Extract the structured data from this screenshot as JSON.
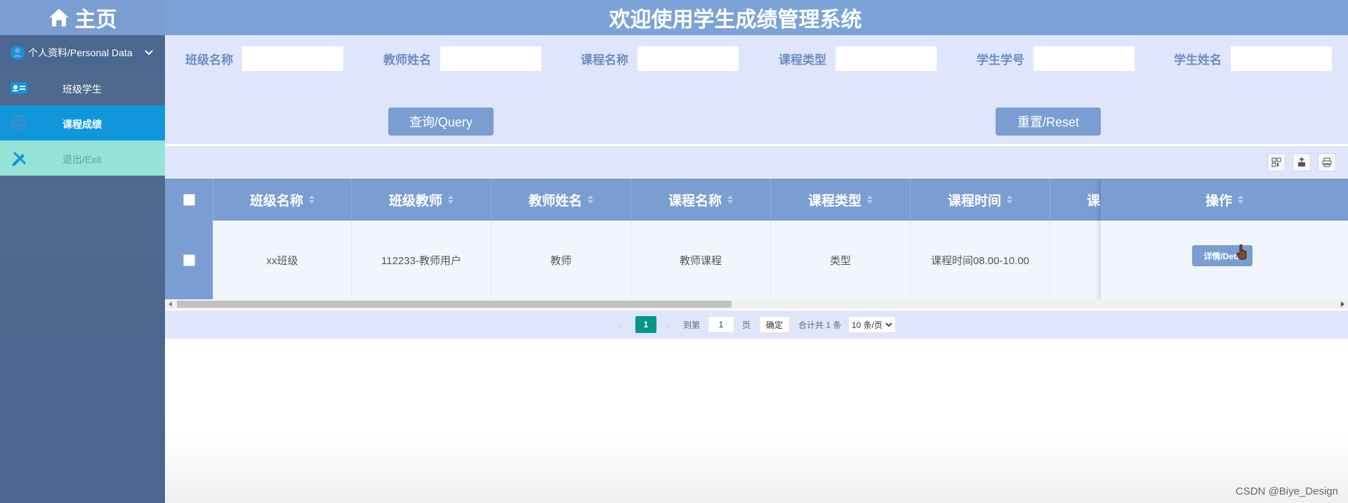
{
  "sidebar": {
    "home_label": "主页",
    "group_label": "个人资料/Personal Data",
    "items": [
      {
        "label": "班级学生",
        "icon": "id-card-icon"
      },
      {
        "label": "课程成绩",
        "icon": "target-icon"
      },
      {
        "label": "退出/Exit",
        "icon": "pencil-ruler-icon"
      }
    ]
  },
  "header": {
    "title": "欢迎使用学生成绩管理系统"
  },
  "search": {
    "fields": [
      "班级名称",
      "教师姓名",
      "课程名称",
      "课程类型",
      "学生学号",
      "学生姓名"
    ],
    "query_button": "查询/Query",
    "reset_button": "重置/Reset"
  },
  "toolbar": {
    "icons": [
      "columns-icon",
      "export-icon",
      "print-icon"
    ]
  },
  "table": {
    "headers": [
      "班级名称",
      "班级教师",
      "教师姓名",
      "课程名称",
      "课程类型",
      "课程时间",
      "课"
    ],
    "action_header": "操作",
    "rows": [
      [
        "xx班级",
        "112233-教师用户",
        "教师",
        "教师课程",
        "类型",
        "课程时间08.00-10.00",
        ""
      ]
    ],
    "detail_button": "详情/Deta"
  },
  "pager": {
    "current_page": "1",
    "goto_label": "到第",
    "page_input": "1",
    "page_unit": "页",
    "confirm": "确定",
    "total": "合计共 1 条",
    "page_size": "10 条/页"
  },
  "watermark": "CSDN @Biye_Design",
  "colors": {
    "sidebar": "#4b6690",
    "header": "#7ba3d7",
    "accent": "#7a9ed2",
    "active_menu": "#1296db",
    "exit_menu": "#94e3d6",
    "pager_current": "#009688"
  }
}
